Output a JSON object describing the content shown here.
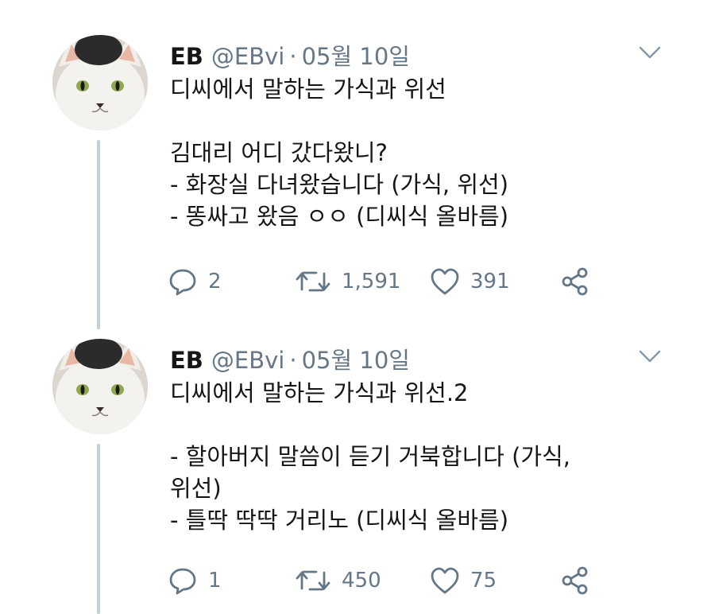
{
  "tweets": [
    {
      "author": {
        "name": "EB",
        "handle": "@EBvi"
      },
      "separator": "·",
      "date": "05월 10일",
      "lines": [
        "디씨에서 말하는 가식과 위선",
        "",
        "김대리 어디 갔다왔니?",
        "- 화장실 다녀왔습니다 (가식, 위선)",
        "- 똥싸고 왔음 ㅇㅇ (디씨식 올바름)"
      ],
      "stats": {
        "replies": "2",
        "retweets": "1,591",
        "likes": "391"
      }
    },
    {
      "author": {
        "name": "EB",
        "handle": "@EBvi"
      },
      "separator": "·",
      "date": "05월 10일",
      "lines": [
        "디씨에서 말하는 가식과 위선.2",
        "",
        "- 할아버지 말씀이 듣기 거북합니다 (가식,",
        "위선)",
        "- 틀딱 딱딱 거리노 (디씨식 올바름)"
      ],
      "stats": {
        "replies": "1",
        "retweets": "450",
        "likes": "75"
      }
    }
  ],
  "icons": {
    "reply": "reply-icon",
    "retweet": "retweet-icon",
    "like": "heart-icon",
    "share": "share-icon",
    "menu": "chevron-down-icon"
  },
  "colors": {
    "text": "#14171a",
    "secondary": "#657786",
    "thread_line": "#c4cfd6"
  }
}
